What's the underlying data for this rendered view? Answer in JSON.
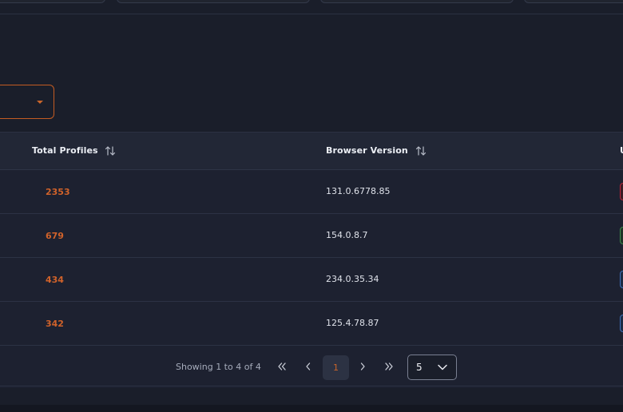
{
  "colors": {
    "accent": "#c9652a",
    "background": "#1a1e2a",
    "header_bg": "#222736"
  },
  "table": {
    "columns": [
      {
        "label": "Total Profiles",
        "sort_icon": "sort-updown-icon"
      },
      {
        "label": "Browser Version",
        "sort_icon": "sort-updown-icon"
      }
    ],
    "rows": [
      {
        "total_profiles": "2353",
        "browser_version": "131.0.6778.85",
        "badge_color": "#b7243a"
      },
      {
        "total_profiles": "679",
        "browser_version": "154.0.8.7",
        "badge_color": "#3f8a4e"
      },
      {
        "total_profiles": "434",
        "browser_version": "234.0.35.34",
        "badge_color": "#3f6fb8"
      },
      {
        "total_profiles": "342",
        "browser_version": "125.4.78.87",
        "badge_color": "#3f6fb8"
      }
    ]
  },
  "pagination": {
    "showing_text": "Showing 1 to 4 of 4",
    "first": "«",
    "prev": "‹",
    "current_page": "1",
    "next": "›",
    "last": "»",
    "page_size": "5"
  }
}
